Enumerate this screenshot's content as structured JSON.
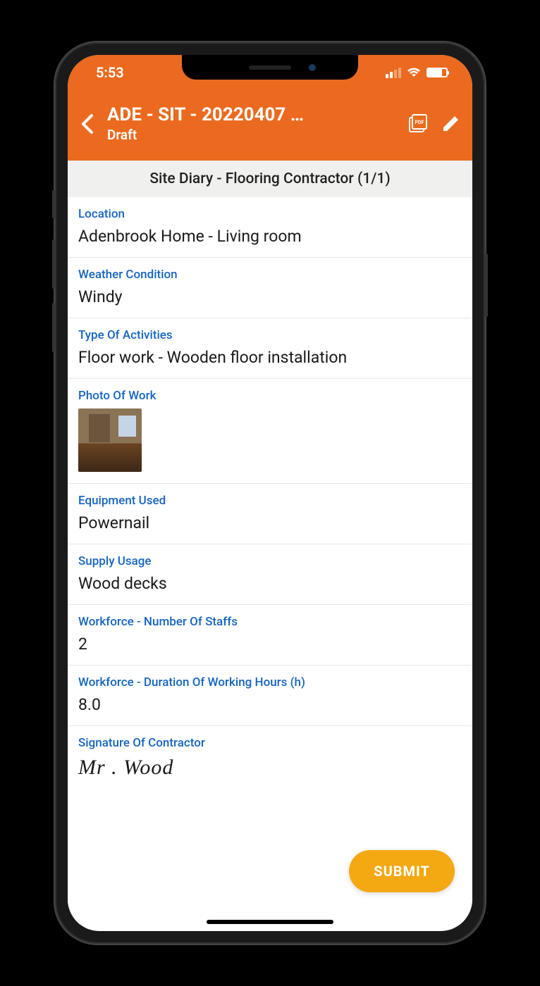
{
  "status_bar": {
    "time": "5:53"
  },
  "header": {
    "title": "ADE - SIT - 20220407 …",
    "status": "Draft"
  },
  "section_header": "Site Diary - Flooring Contractor (1/1)",
  "fields": {
    "location": {
      "label": "Location",
      "value": "Adenbrook Home - Living room"
    },
    "weather": {
      "label": "Weather Condition",
      "value": "Windy"
    },
    "activities": {
      "label": "Type Of Activities",
      "value": "Floor work - Wooden floor installation"
    },
    "photo": {
      "label": "Photo Of Work"
    },
    "equipment": {
      "label": "Equipment Used",
      "value": "Powernail"
    },
    "supply": {
      "label": "Supply Usage",
      "value": "Wood decks"
    },
    "staffs": {
      "label": "Workforce - Number Of Staffs",
      "value": "2"
    },
    "hours": {
      "label": "Workforce - Duration Of Working Hours (h)",
      "value": "8.0"
    },
    "signature": {
      "label": "Signature Of Contractor",
      "value": "Mr . Wood"
    }
  },
  "submit_label": "SUBMIT"
}
